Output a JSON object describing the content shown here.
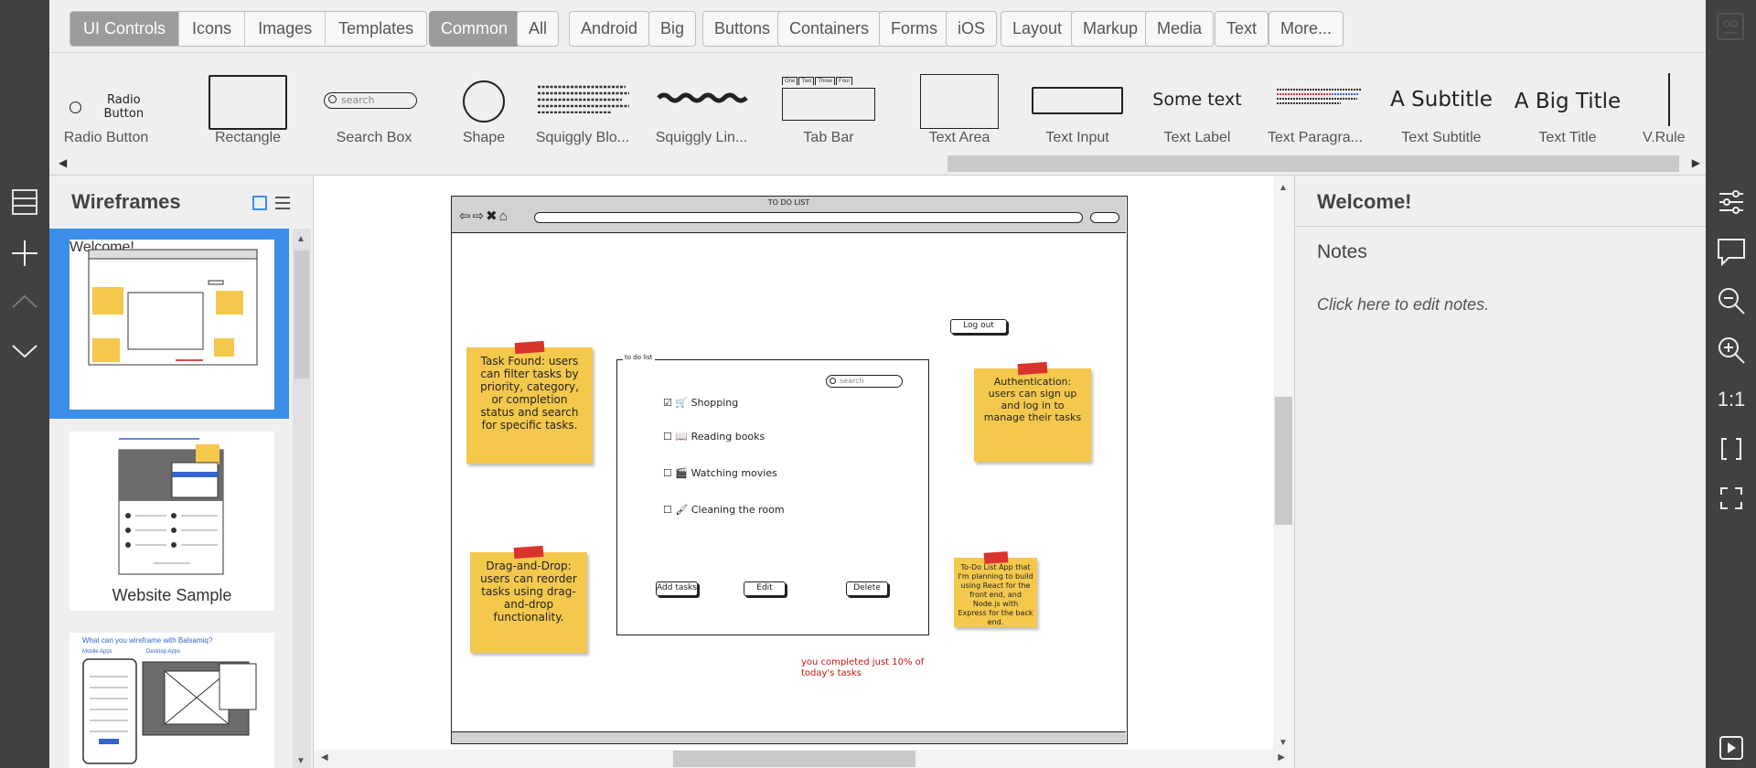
{
  "library": {
    "categories": [
      "UI Controls",
      "Icons",
      "Images",
      "Templates"
    ],
    "filters": [
      "Common",
      "All",
      "Android",
      "Big",
      "Buttons",
      "Containers",
      "Forms",
      "iOS",
      "Layout",
      "Markup",
      "Media",
      "Text",
      "More..."
    ],
    "selected_category": "UI Controls",
    "selected_filter": "Common",
    "controls": [
      {
        "label": "Radio Button",
        "preview": "Radio Button"
      },
      {
        "label": "Rectangle"
      },
      {
        "label": "Search Box",
        "preview": "search"
      },
      {
        "label": "Shape"
      },
      {
        "label": "Squiggly Blo..."
      },
      {
        "label": "Squiggly Lin..."
      },
      {
        "label": "Tab Bar",
        "tabs": [
          "One",
          "Two",
          "Three",
          "Four"
        ]
      },
      {
        "label": "Text Area"
      },
      {
        "label": "Text Input"
      },
      {
        "label": "Text Label",
        "preview": "Some text"
      },
      {
        "label": "Text Paragra..."
      },
      {
        "label": "Text Subtitle",
        "preview": "A Subtitle"
      },
      {
        "label": "Text Title",
        "preview": "A Big Title"
      },
      {
        "label": "V.Rule"
      }
    ]
  },
  "wireframes": {
    "title": "Wireframes",
    "items": [
      {
        "label": "Welcome!",
        "selected": true
      },
      {
        "label": "Website Sample",
        "selected": false
      },
      {
        "label": "",
        "selected": false,
        "caption": "What can you wireframe with Balsamiq?"
      }
    ],
    "sample_caption": "What can you wireframe with Balsamiq?",
    "sample2_labels": [
      "Mobile Apps",
      "Desktop Apps"
    ]
  },
  "mockup": {
    "browser_title": "TO DO LIST",
    "logout_label": "Log out",
    "list_title": "to do list",
    "search_placeholder": "search",
    "tasks": [
      "Shopping",
      "Reading books",
      "Watching movies",
      "Cleaning the room"
    ],
    "buttons": [
      "Add tasks",
      "Edit",
      "Delete"
    ],
    "progress_text": "you completed just 10% of today's tasks",
    "notes": {
      "task_found": "Task Found: users can filter tasks by priority, category, or completion status and search for specific tasks.",
      "auth": "Authentication: users can sign up and log in to manage their tasks",
      "dragdrop": "Drag-and-Drop: users can reorder tasks using drag-and-drop functionality.",
      "stack": "To-Do List App that I'm planning to build using React for the front end, and Node.js with Express for the back end."
    }
  },
  "notes_panel": {
    "title": "Welcome!",
    "notes_label": "Notes",
    "placeholder": "Click here to edit notes."
  },
  "right_rail": {
    "zoom_actual": "1:1"
  },
  "colors": {
    "dark": "#3f4143",
    "selected_blue": "#3d8ee8",
    "sticky": "#f4c84d",
    "tape": "#d9342b",
    "progress_red": "#cc1111"
  }
}
